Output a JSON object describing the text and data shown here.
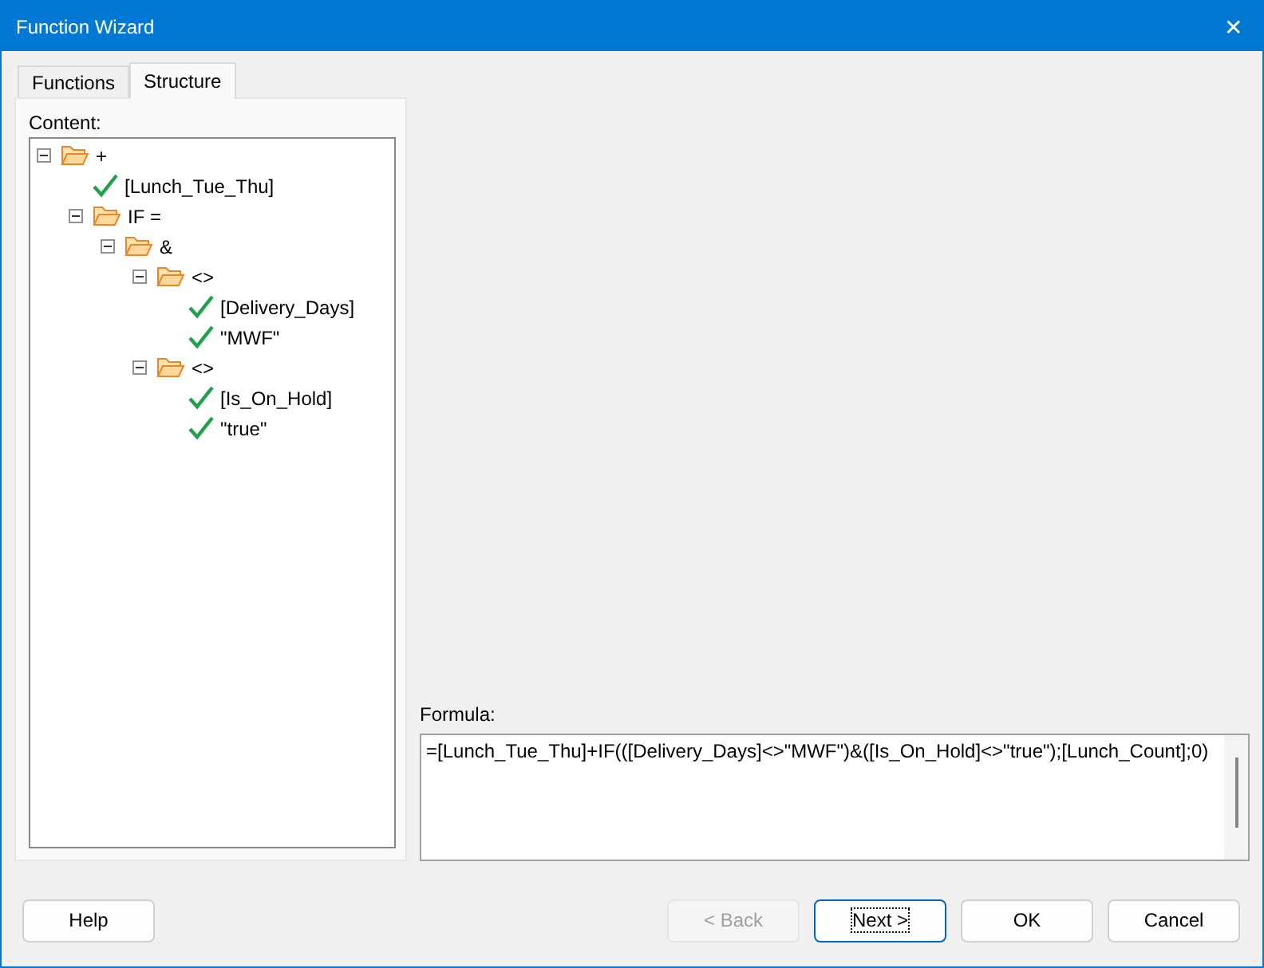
{
  "window": {
    "title": "Function Wizard",
    "close": "✕"
  },
  "tabs": [
    {
      "label": "Functions",
      "selected": false
    },
    {
      "label": "Structure",
      "selected": true
    }
  ],
  "content": {
    "label": "Content:",
    "tree": [
      {
        "kind": "folder",
        "label": "+",
        "expanded": true,
        "children": [
          {
            "kind": "check",
            "label": "[Lunch_Tue_Thu]"
          },
          {
            "kind": "folder",
            "label": "IF =",
            "expanded": true,
            "children": [
              {
                "kind": "folder",
                "label": "&",
                "expanded": true,
                "children": [
                  {
                    "kind": "folder",
                    "label": "<>",
                    "expanded": true,
                    "children": [
                      {
                        "kind": "check",
                        "label": "[Delivery_Days]"
                      },
                      {
                        "kind": "check",
                        "label": "\"MWF\""
                      }
                    ]
                  },
                  {
                    "kind": "folder",
                    "label": "<>",
                    "expanded": true,
                    "children": [
                      {
                        "kind": "check",
                        "label": "[Is_On_Hold]"
                      },
                      {
                        "kind": "check",
                        "label": "\"true\""
                      }
                    ]
                  }
                ]
              }
            ]
          }
        ]
      }
    ]
  },
  "formula": {
    "label": "Formula:",
    "value": "=[Lunch_Tue_Thu]+IF(([Delivery_Days]<>\"MWF\")&([Is_On_Hold]<>\"true\");[Lunch_Count];0)"
  },
  "buttons": [
    {
      "label": "Help",
      "disabled": false,
      "focused": false
    },
    {
      "label": "< Back",
      "disabled": true,
      "focused": false
    },
    {
      "label": "Next >",
      "disabled": false,
      "focused": true
    },
    {
      "label": "OK",
      "disabled": false,
      "focused": false
    },
    {
      "label": "Cancel",
      "disabled": false,
      "focused": false
    }
  ]
}
